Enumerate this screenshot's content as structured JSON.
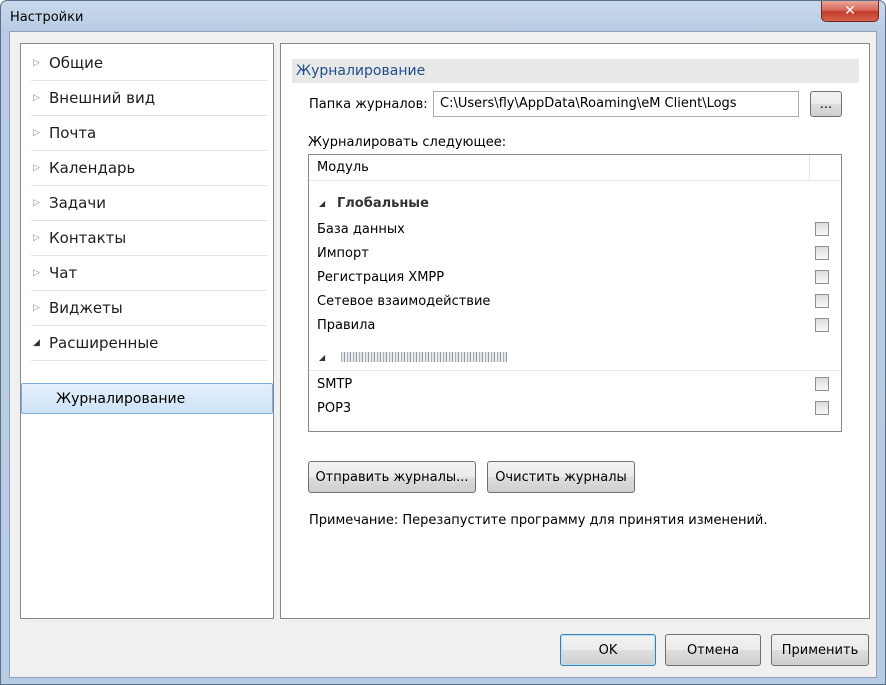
{
  "window": {
    "title": "Настройки",
    "close_icon": "close-icon"
  },
  "sidebar": {
    "items": [
      {
        "label": "Общие",
        "arrow": "▷"
      },
      {
        "label": "Внешний вид",
        "arrow": "▷"
      },
      {
        "label": "Почта",
        "arrow": "▷"
      },
      {
        "label": "Календарь",
        "arrow": "▷"
      },
      {
        "label": "Задачи",
        "arrow": "▷"
      },
      {
        "label": "Контакты",
        "arrow": "▷"
      },
      {
        "label": "Чат",
        "arrow": "▷"
      },
      {
        "label": "Виджеты",
        "arrow": "▷"
      },
      {
        "label": "Расширенные",
        "arrow": "◢"
      }
    ],
    "selected_sub": "Журналирование"
  },
  "panel": {
    "title": "Журналирование",
    "folder_label": "Папка журналов:",
    "folder_value": "C:\\Users\\fly\\AppData\\Roaming\\eM Client\\Logs",
    "browse_label": "...",
    "log_following_label": "Журналировать следующее:",
    "list": {
      "column_header": "Модуль",
      "group_arrow": "◢",
      "global_group": "Глобальные",
      "global_items": [
        "База данных",
        "Импорт",
        "Регистрация XMPP",
        "Сетевое взаимодействие",
        "Правила"
      ],
      "account_items": [
        "SMTP",
        "POP3"
      ]
    },
    "send_logs_label": "Отправить журналы...",
    "clear_logs_label": "Очистить журналы",
    "note": "Примечание: Перезапустите программу для принятия изменений."
  },
  "footer": {
    "ok_label": "OK",
    "cancel_label": "Отмена",
    "apply_label": "Применить"
  }
}
